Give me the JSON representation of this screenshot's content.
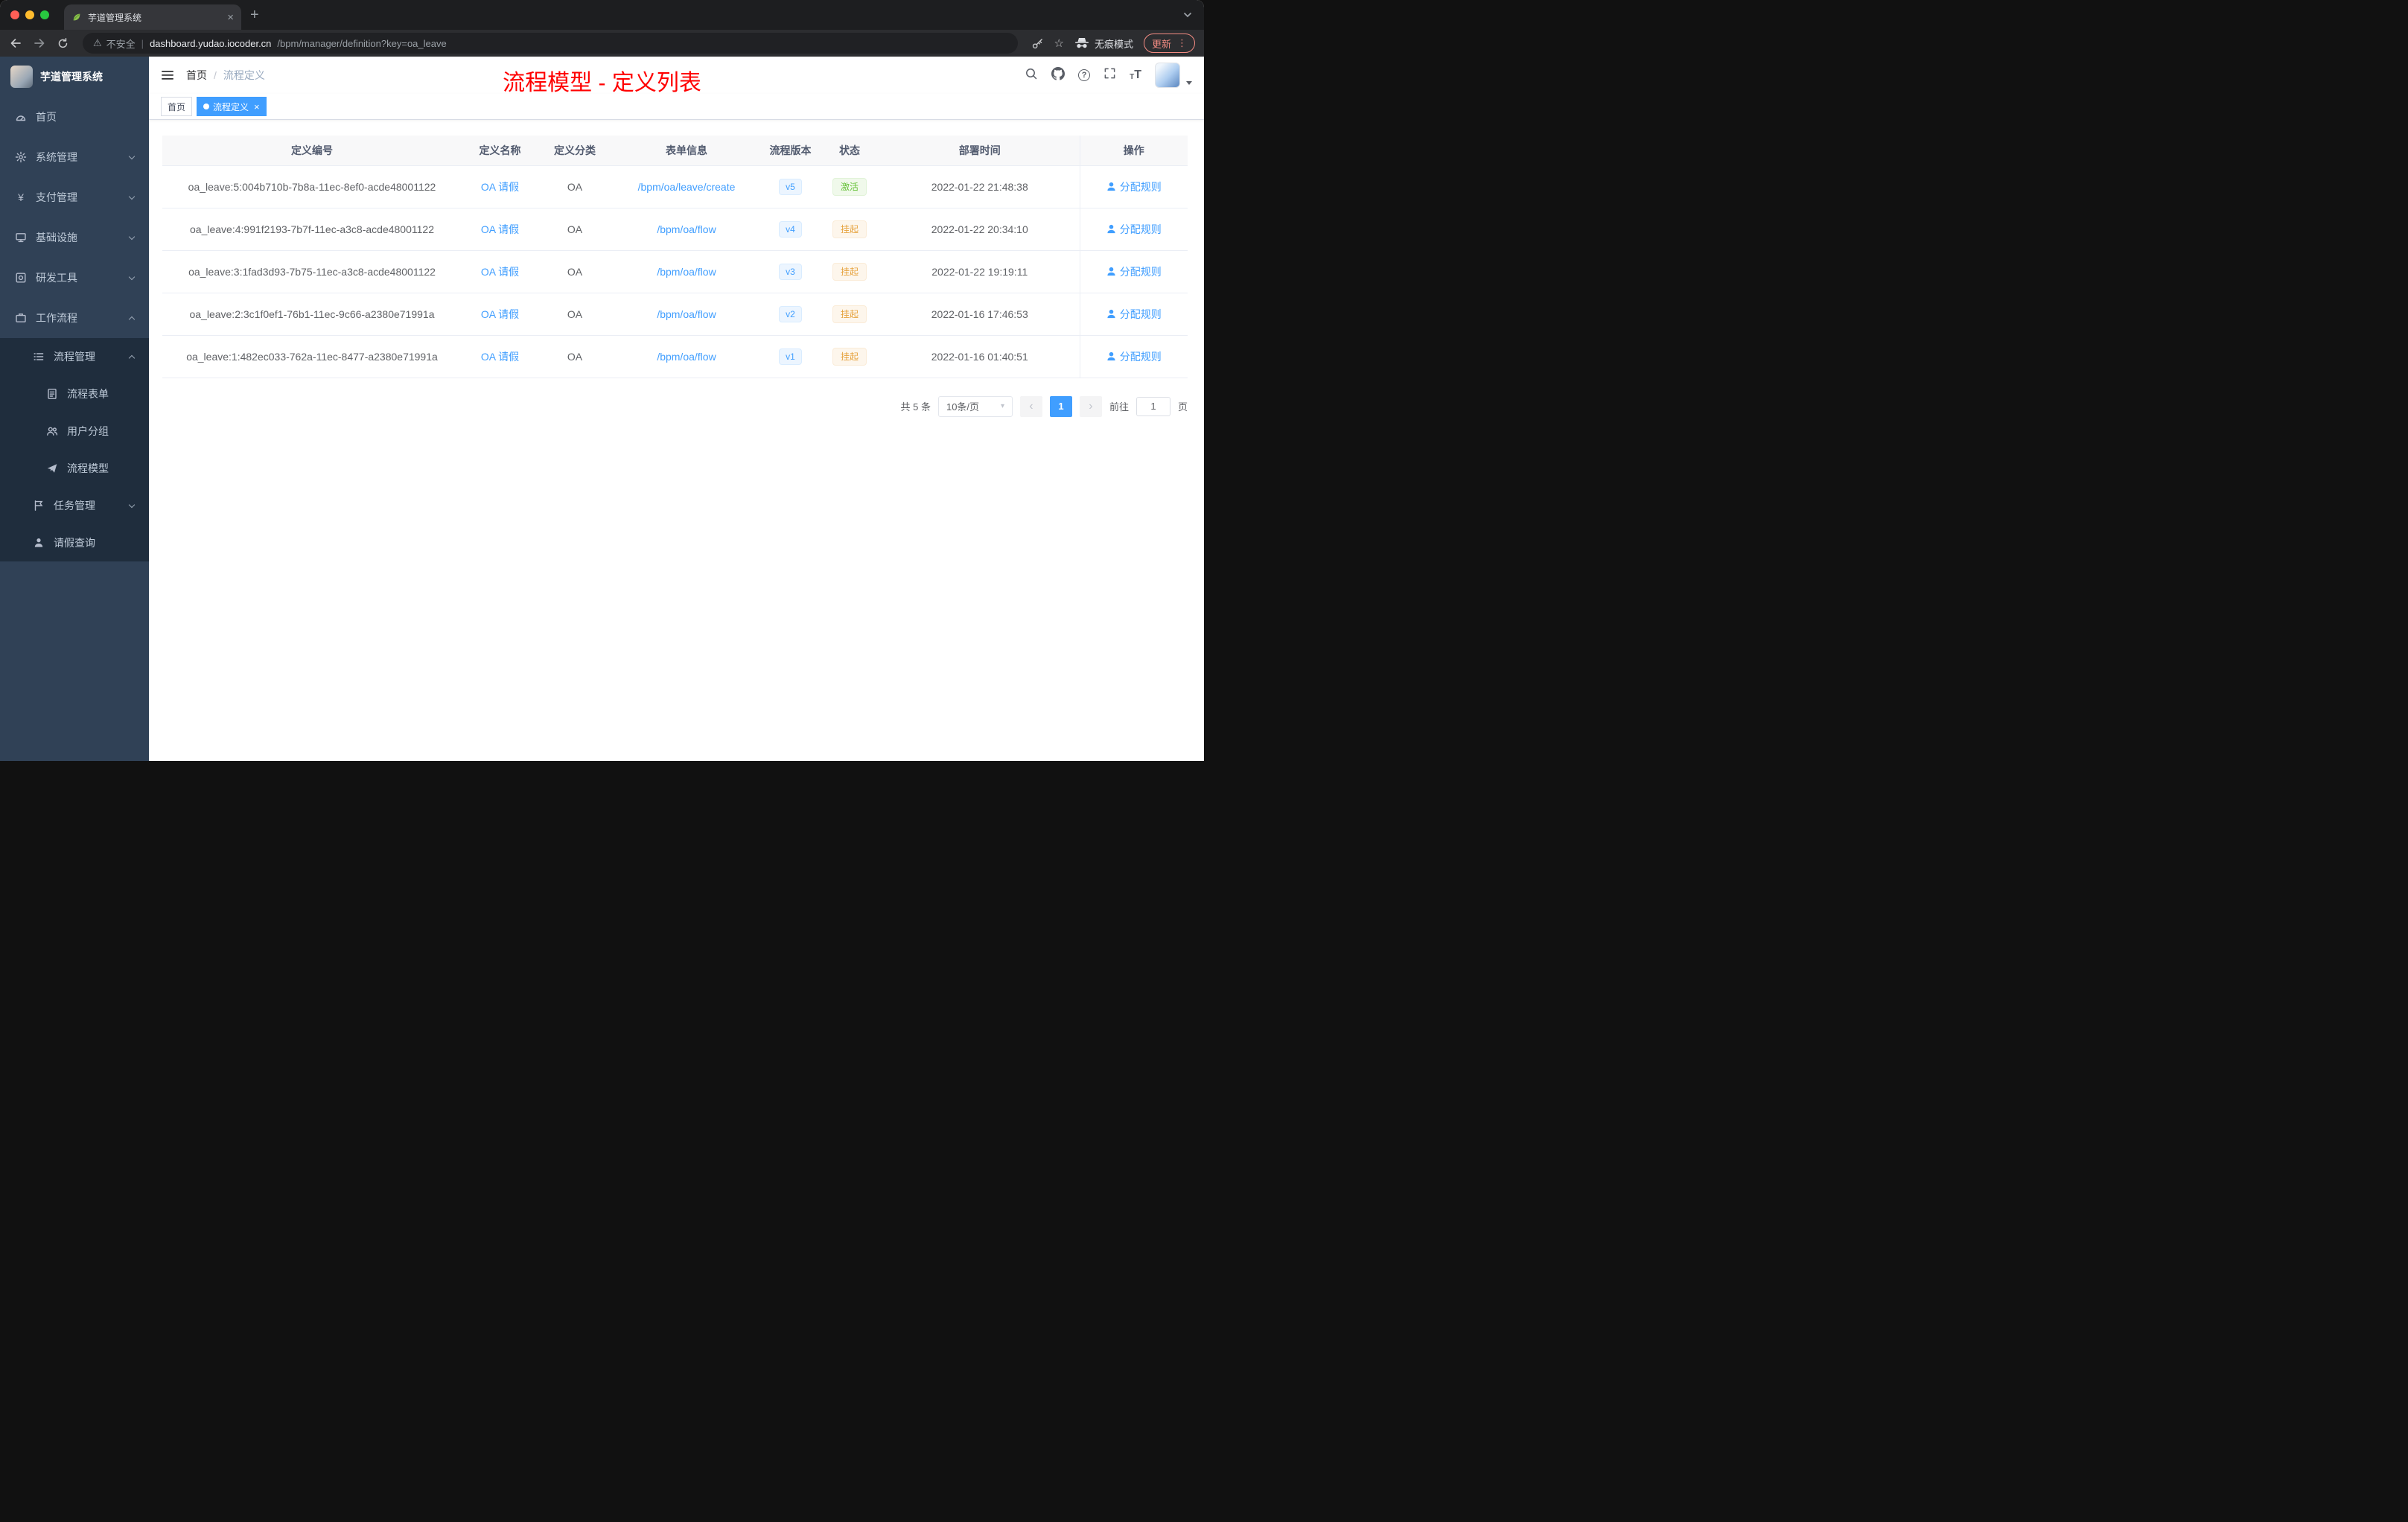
{
  "colors": {
    "accent": "#409eff",
    "success": "#67c23a",
    "warning": "#e6a23c",
    "annotation_red": "#ff0000"
  },
  "browser": {
    "tab": {
      "title": "芋道管理系统"
    },
    "toolbar": {
      "security_label": "不安全",
      "url_domain": "dashboard.yudao.iocoder.cn",
      "url_path": "/bpm/manager/definition?key=oa_leave",
      "incognito_label": "无痕模式",
      "update_label": "更新"
    }
  },
  "sidebar": {
    "logo_title": "芋道管理系统",
    "items": [
      {
        "label": "首页"
      },
      {
        "label": "系统管理"
      },
      {
        "label": "支付管理"
      },
      {
        "label": "基础设施"
      },
      {
        "label": "研发工具"
      },
      {
        "label": "工作流程"
      },
      {
        "label": "流程管理"
      },
      {
        "label": "流程表单"
      },
      {
        "label": "用户分组"
      },
      {
        "label": "流程模型"
      },
      {
        "label": "任务管理"
      },
      {
        "label": "请假查询"
      }
    ]
  },
  "header": {
    "breadcrumb_home": "首页",
    "breadcrumb_current": "流程定义",
    "annotation": "流程模型 - 定义列表"
  },
  "tags": {
    "home": "首页",
    "active": "流程定义"
  },
  "table": {
    "headers": [
      "定义编号",
      "定义名称",
      "定义分类",
      "表单信息",
      "流程版本",
      "状态",
      "部署时间",
      "操作"
    ],
    "rows": [
      {
        "id": "oa_leave:5:004b710b-7b8a-11ec-8ef0-acde48001122",
        "name": "OA 请假",
        "category": "OA",
        "form": "/bpm/oa/leave/create",
        "version": "v5",
        "status": "激活",
        "status_type": "success",
        "time": "2022-01-22 21:48:38",
        "action": "分配规则"
      },
      {
        "id": "oa_leave:4:991f2193-7b7f-11ec-a3c8-acde48001122",
        "name": "OA 请假",
        "category": "OA",
        "form": "/bpm/oa/flow",
        "version": "v4",
        "status": "挂起",
        "status_type": "warning",
        "time": "2022-01-22 20:34:10",
        "action": "分配规则"
      },
      {
        "id": "oa_leave:3:1fad3d93-7b75-11ec-a3c8-acde48001122",
        "name": "OA 请假",
        "category": "OA",
        "form": "/bpm/oa/flow",
        "version": "v3",
        "status": "挂起",
        "status_type": "warning",
        "time": "2022-01-22 19:19:11",
        "action": "分配规则"
      },
      {
        "id": "oa_leave:2:3c1f0ef1-76b1-11ec-9c66-a2380e71991a",
        "name": "OA 请假",
        "category": "OA",
        "form": "/bpm/oa/flow",
        "version": "v2",
        "status": "挂起",
        "status_type": "warning",
        "time": "2022-01-16 17:46:53",
        "action": "分配规则"
      },
      {
        "id": "oa_leave:1:482ec033-762a-11ec-8477-a2380e71991a",
        "name": "OA 请假",
        "category": "OA",
        "form": "/bpm/oa/flow",
        "version": "v1",
        "status": "挂起",
        "status_type": "warning",
        "time": "2022-01-16 01:40:51",
        "action": "分配规则"
      }
    ]
  },
  "pagination": {
    "total": "共 5 条",
    "page_size": "10条/页",
    "current_page": "1",
    "goto_label": "前往",
    "goto_value": "1",
    "page_unit": "页"
  }
}
